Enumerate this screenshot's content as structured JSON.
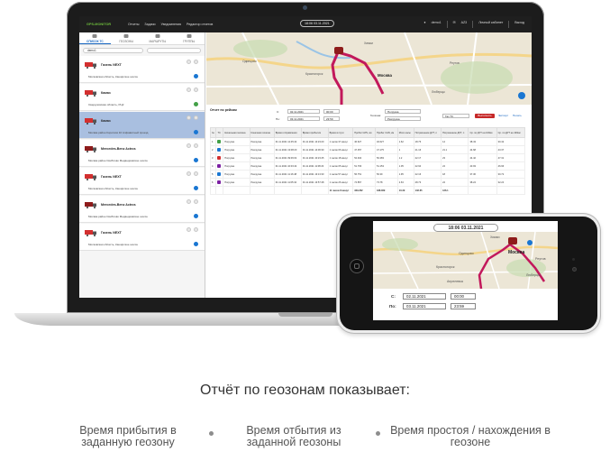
{
  "app": {
    "logo": "GPS-MONITOR",
    "nav": [
      "Отчеты",
      "Задачи",
      "Уведомления",
      "Редактор отчетов"
    ],
    "clock": "18:06 03.11.2021",
    "user": "demo1",
    "code": "AZ3",
    "cabinet": "Личный кабинет",
    "logout": "Выход"
  },
  "sidebar": {
    "tabs": [
      "СПИСОК ТС",
      "ГЕОЗОНЫ",
      "МАРШРУТЫ",
      "ГРУППЫ"
    ],
    "search": "demo1",
    "vehicles": [
      {
        "name": "Газель NEXT",
        "addr": "Московская область, Каширское шоссе",
        "color": "#d32f2f",
        "status": "#1976d2",
        "selected": false
      },
      {
        "name": "Камаз",
        "addr": "Свердловская область, РЦ2",
        "color": "#d32f2f",
        "status": "#43a047",
        "selected": false
      },
      {
        "name": "Камаз",
        "addr": "Москва район Коротков 10 Алфавитный проезд",
        "color": "#d32f2f",
        "status": "#1976d2",
        "selected": true
      },
      {
        "name": "Mercedes-Benz Actros",
        "addr": "Москва район Свиблово Медведковское шоссе",
        "color": "#8e1b1b",
        "status": "#1976d2",
        "selected": false
      },
      {
        "name": "Газель NEXT",
        "addr": "Московская область, Каширское шоссе",
        "color": "#d32f2f",
        "status": "#1976d2",
        "selected": false
      },
      {
        "name": "Mercedes-Benz Actros",
        "addr": "Москва район Свиблово Медведковское шоссе",
        "color": "#8e1b1b",
        "status": "#1976d2",
        "selected": false
      },
      {
        "name": "Газель NEXT",
        "addr": "Московская область, Каширское шоссе",
        "color": "#d32f2f",
        "status": "#1976d2",
        "selected": false
      }
    ]
  },
  "map_labels": {
    "laptop": [
      "Одинцово",
      "Москва",
      "Химки",
      "Люберцы",
      "Реутов",
      "Красногорск"
    ],
    "phone": [
      "Москва",
      "Одинцово",
      "Люберцы",
      "Реутов",
      "Красногорск",
      "Апрелевка",
      "Химки"
    ]
  },
  "report": {
    "title": "Отчет по рейсам",
    "from_label": "С:",
    "to_label": "По:",
    "date_from": "02.11.2021",
    "time_from": "00:00",
    "date_to": "03.11.2021",
    "time_to": "23:59",
    "geozone_label": "Геозона:",
    "geozone_a": "Погрузка",
    "geozone_b": "Разгрузка",
    "vehicle_field": "Газ ТС",
    "button": "Выполнить",
    "export": "Экспорт",
    "print": "Печать",
    "columns": [
      "№",
      "ТС",
      "Начальная геозона",
      "Конечная геозона",
      "Время отправления",
      "Время прибытия",
      "Время в пути",
      "Пробег GPS, км",
      "Пробег CAN, км",
      "Мото-часы",
      "Потраченное ДУТ, л",
      "Потраченное ДУТ, л",
      "Ср. по ДУТ на 100км",
      "Ср. по ДУТ на 100км"
    ],
    "rows": [
      [
        "1",
        "#43a047",
        "Погрузка",
        "Разгрузка",
        "01.11.2021 12:45:44",
        "01.11.2021 14:23:20",
        "1 часов 37 минут",
        "46.627",
        "46.627",
        "1.62",
        "18.76",
        "14",
        "38.43",
        "30.42"
      ],
      [
        "2",
        "#1976d2",
        "Погрузка",
        "Разгрузка",
        "01.11.2021 13:08:20",
        "01.11.2021 14:06:30",
        "1 часов 06 минут",
        "47.357",
        "47.175",
        "1",
        "21.16",
        "21.1",
        "44.68",
        "43.37"
      ],
      [
        "3",
        "#d32f2f",
        "Погрузка",
        "Разгрузка",
        "01.11.2021 09:06:04",
        "01.11.2021 10:23:45",
        "1 часов 18 минут",
        "52.494",
        "50.283",
        "1.2",
        "22.17",
        "23",
        "44.42",
        "47.31"
      ],
      [
        "4",
        "#7b1fa2",
        "Погрузка",
        "Разгрузка",
        "01.11.2021 10:03:44",
        "01.11.2021 11:08:23",
        "1 часов 05 минут",
        "51.766",
        "51.153",
        "1.05",
        "22.94",
        "24",
        "43.93",
        "46.96"
      ],
      [
        "5",
        "#1976d2",
        "Погрузка",
        "Разгрузка",
        "01.11.2021 11:16:48",
        "01.11.2021 13:13:30",
        "1 часов 57 минут",
        "56.751",
        "56.39",
        "1.95",
        "22.16",
        "18",
        "37.36",
        "30.72"
      ],
      [
        "6",
        "#7b1fa2",
        "Погрузка",
        "Разгрузка",
        "01.11.2021 11:05:34",
        "01.11.2021 13:57:48",
        "1 часов 26 минут",
        "74.857",
        "73.78",
        "2.63",
        "28.73",
        "24",
        "38.24",
        "32.24"
      ]
    ],
    "totals": [
      "11 часов 8 минут",
      "339.262",
      "338.069",
      "10.39",
      "132.65",
      "126.1"
    ]
  },
  "phone": {
    "clock": "18:06 03.11.2021",
    "from_label": "С:",
    "to_label": "По:",
    "date_from": "02.11.2021",
    "time_from": "00:00",
    "date_to": "03.11.2021",
    "time_to": "23:59"
  },
  "caption": "Отчёт по геозонам показывает:",
  "features": [
    "Время прибытия в заданную геозону",
    "Время отбытия из заданной геозоны",
    "Время простоя / нахождения в геозоне"
  ]
}
